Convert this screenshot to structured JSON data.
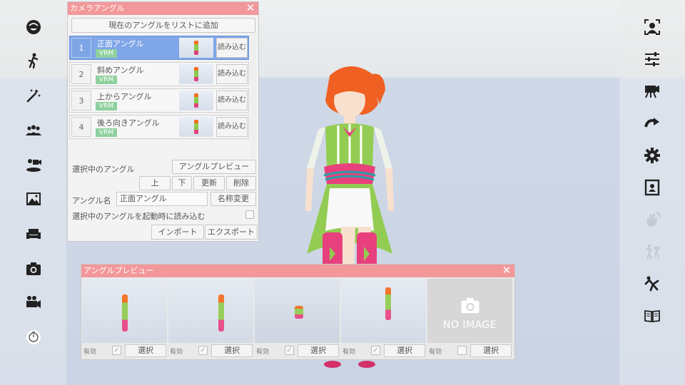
{
  "camera_panel": {
    "title": "カメラアングル",
    "add_button": "現在のアングルをリストに追加",
    "angles": [
      {
        "number": "1",
        "name": "正面アングル",
        "badge": "VRM",
        "load": "読み込む",
        "selected": true
      },
      {
        "number": "2",
        "name": "斜めアングル",
        "badge": "VRM",
        "load": "読み込む",
        "selected": false
      },
      {
        "number": "3",
        "name": "上からアングル",
        "badge": "VRM",
        "load": "読み込む",
        "selected": false
      },
      {
        "number": "4",
        "name": "後ろ向きアングル",
        "badge": "VRM",
        "load": "読み込む",
        "selected": false
      }
    ],
    "selected_label": "選択中のアングル",
    "preview_button": "アングルプレビュー",
    "up_button": "上",
    "down_button": "下",
    "update_button": "更新",
    "delete_button": "削除",
    "name_label": "アングル名",
    "name_value": "正面アングル",
    "rename_button": "名称変更",
    "load_on_start_label": "選択中のアングルを起動時に読み込む",
    "import_button": "インポート",
    "export_button": "エクスポート"
  },
  "preview_panel": {
    "title": "アングルプレビュー",
    "cells": [
      {
        "enabled_label": "有効",
        "checked": true,
        "select_label": "選択"
      },
      {
        "enabled_label": "有効",
        "checked": true,
        "select_label": "選択"
      },
      {
        "enabled_label": "有効",
        "checked": true,
        "select_label": "選択"
      },
      {
        "enabled_label": "有効",
        "checked": true,
        "select_label": "選択"
      },
      {
        "enabled_label": "有効",
        "checked": false,
        "select_label": "選択"
      }
    ],
    "no_image_text": "NO IMAGE"
  },
  "left_sidebar_icons": [
    "face-icon",
    "pose-icon",
    "magic-wand-icon",
    "people-icon",
    "camera-stage-icon",
    "image-icon",
    "sofa-icon",
    "camera-icon",
    "video-camera-icon",
    "timer-icon"
  ],
  "right_sidebar_icons": [
    "face-frame-icon",
    "sliders-icon",
    "video-record-icon",
    "redo-arrow-icon",
    "gear-icon",
    "portrait-icon",
    "hand-wave-icon",
    "person-tripod-icon",
    "action-figure-icon",
    "book-icon"
  ],
  "colors": {
    "title_bar": "#f2989a",
    "selected_item": "#7fa6e8",
    "vrm_badge": "#8fd19e"
  }
}
